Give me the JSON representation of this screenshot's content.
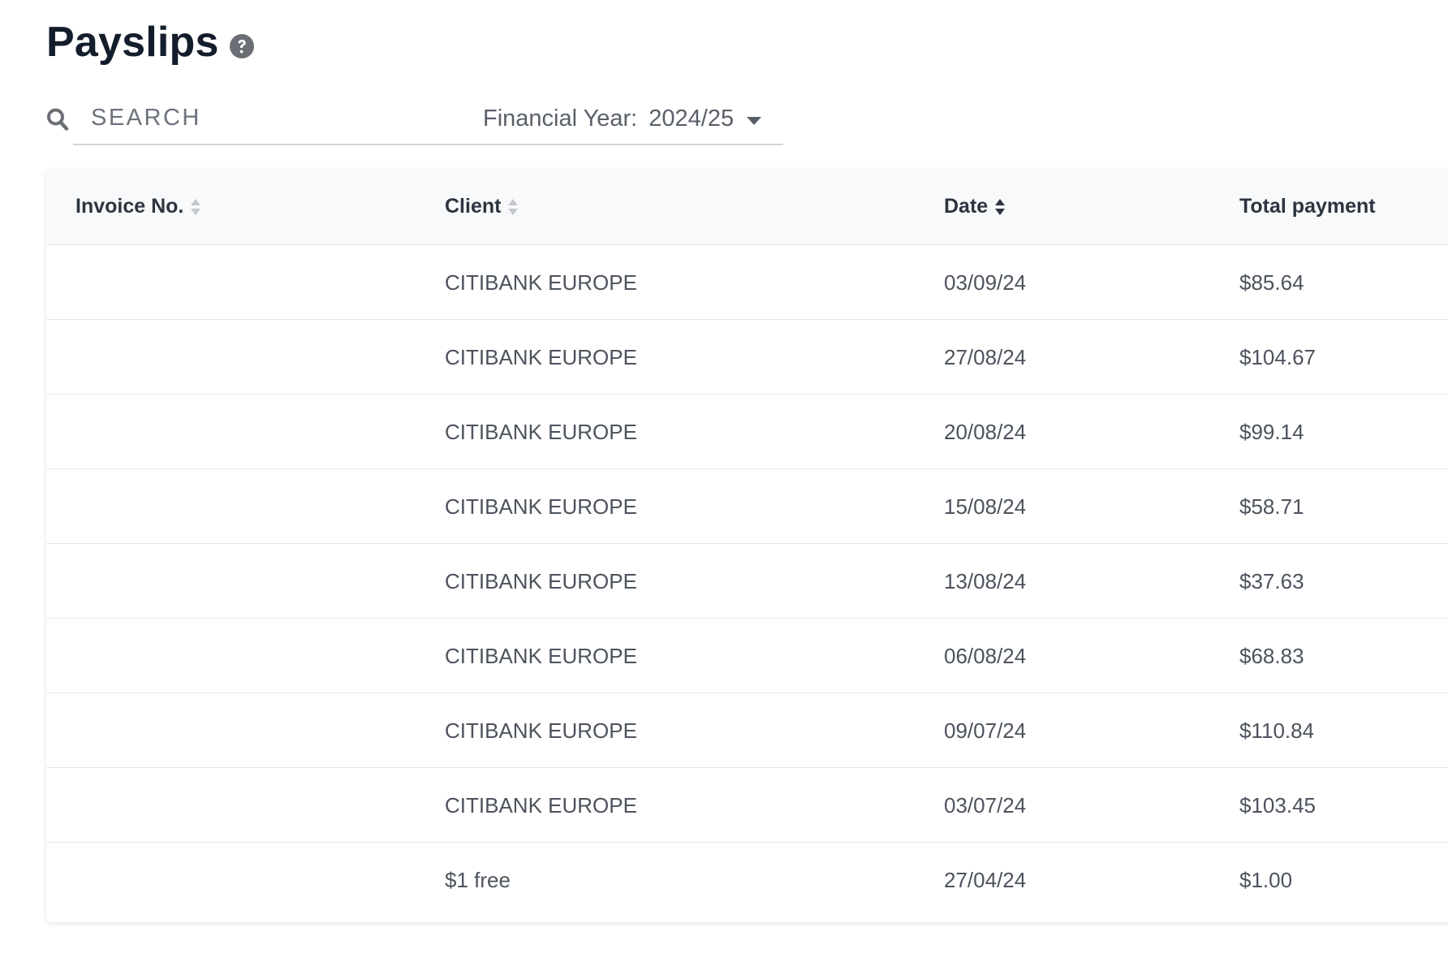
{
  "header": {
    "title": "Payslips",
    "help_icon": "question-circle-icon"
  },
  "search": {
    "icon": "search-icon",
    "placeholder": "SEARCH",
    "value": ""
  },
  "financial_year": {
    "label": "Financial Year:",
    "value": "2024/25",
    "icon": "chevron-down-icon"
  },
  "table": {
    "columns": [
      {
        "key": "invoice",
        "label": "Invoice No.",
        "sortable": true,
        "sort": "none"
      },
      {
        "key": "client",
        "label": "Client",
        "sortable": true,
        "sort": "none"
      },
      {
        "key": "date",
        "label": "Date",
        "sortable": true,
        "sort": "desc"
      },
      {
        "key": "total",
        "label": "Total payment",
        "sortable": false,
        "sort": "none"
      }
    ],
    "rows": [
      {
        "invoice": "",
        "client": "CITIBANK EUROPE",
        "date": "03/09/24",
        "total": "$85.64"
      },
      {
        "invoice": "",
        "client": "CITIBANK EUROPE",
        "date": "27/08/24",
        "total": "$104.67"
      },
      {
        "invoice": "",
        "client": "CITIBANK EUROPE",
        "date": "20/08/24",
        "total": "$99.14"
      },
      {
        "invoice": "",
        "client": "CITIBANK EUROPE",
        "date": "15/08/24",
        "total": "$58.71"
      },
      {
        "invoice": "",
        "client": "CITIBANK EUROPE",
        "date": "13/08/24",
        "total": "$37.63"
      },
      {
        "invoice": "",
        "client": "CITIBANK EUROPE",
        "date": "06/08/24",
        "total": "$68.83"
      },
      {
        "invoice": "",
        "client": "CITIBANK EUROPE",
        "date": "09/07/24",
        "total": "$110.84"
      },
      {
        "invoice": "",
        "client": "CITIBANK EUROPE",
        "date": "03/07/24",
        "total": "$103.45"
      },
      {
        "invoice": "",
        "client": "$1 free",
        "date": "27/04/24",
        "total": "$1.00"
      }
    ]
  },
  "colors": {
    "title": "#141d2b",
    "header_bg": "#f8f9fa",
    "border": "#e5e7ea",
    "icon_grey": "#6b6f75",
    "sort_inactive": "#c4c7cc",
    "sort_active": "#2c3440"
  }
}
